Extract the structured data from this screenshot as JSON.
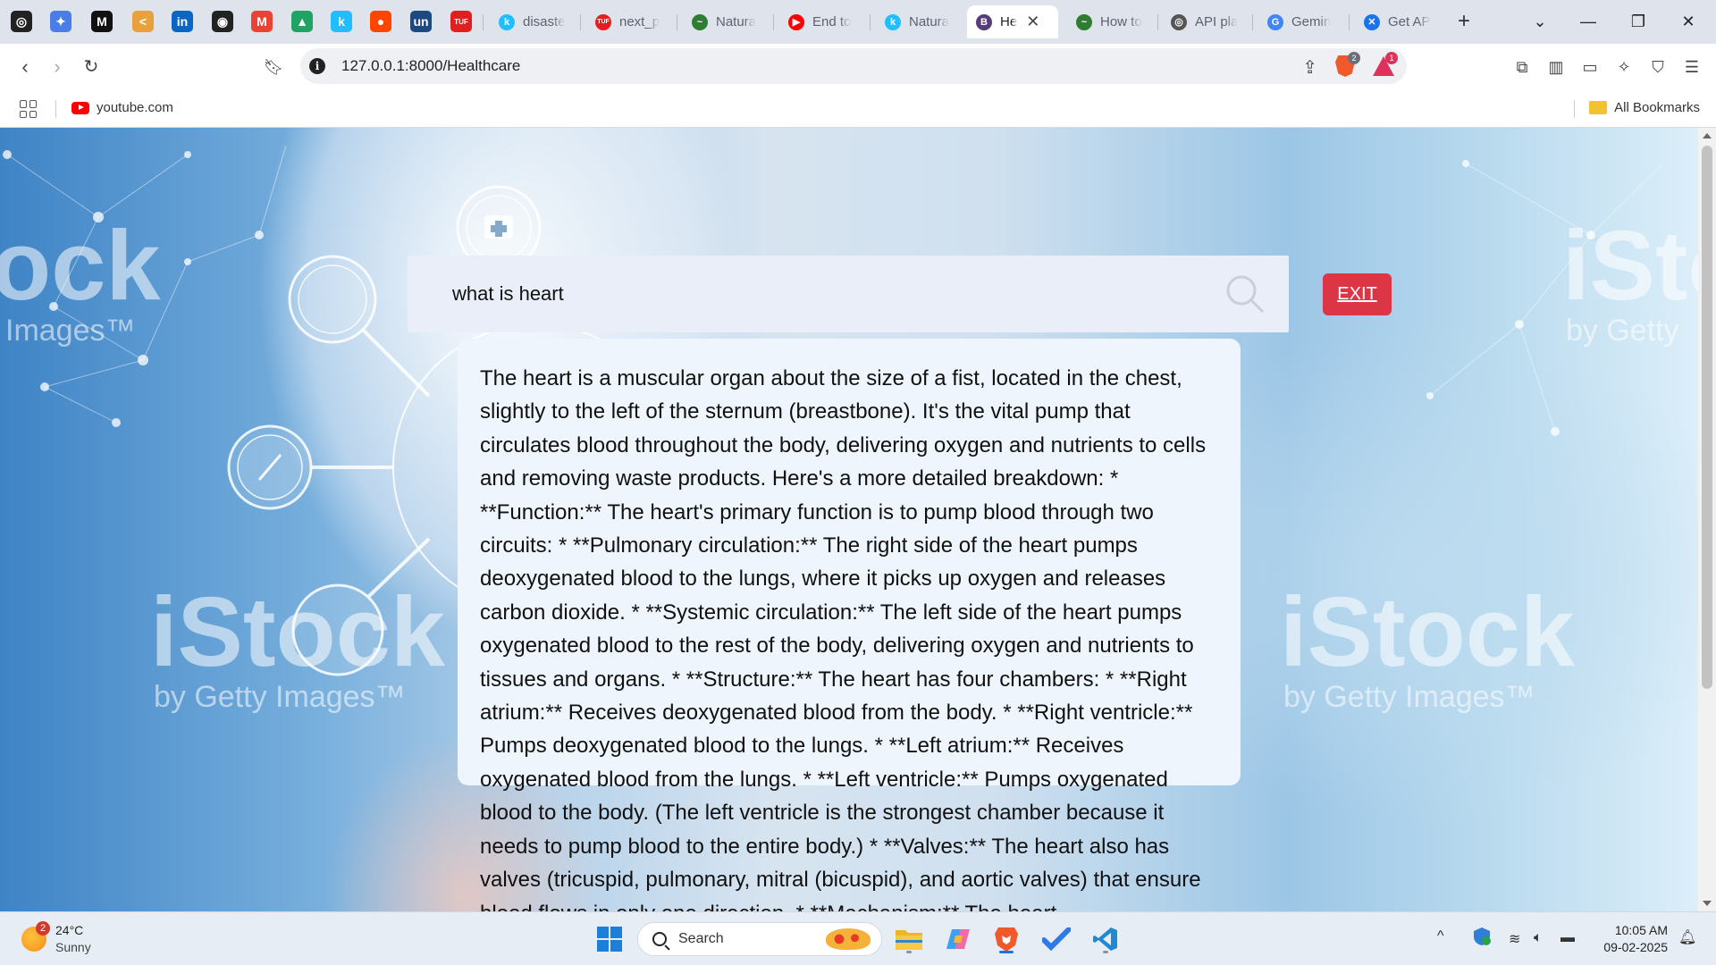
{
  "browser": {
    "pinned_tabs": [
      {
        "name": "openai-icon",
        "glyph": "◎",
        "color": "#222222"
      },
      {
        "name": "gemini-icon",
        "glyph": "✦",
        "color": "#4a7de8"
      },
      {
        "name": "medium-icon",
        "glyph": "M",
        "color": "#111111"
      },
      {
        "name": "claude-icon",
        "glyph": "<",
        "color": "#e9a23b"
      },
      {
        "name": "linkedin-icon",
        "glyph": "in",
        "color": "#0a66c2"
      },
      {
        "name": "github-icon",
        "glyph": "◉",
        "color": "#222222"
      },
      {
        "name": "gmail-icon",
        "glyph": "M",
        "color": "#ea4335"
      },
      {
        "name": "google-drive-icon",
        "glyph": "▲",
        "color": "#1fa463"
      },
      {
        "name": "kaggle-icon",
        "glyph": "k",
        "color": "#20beff"
      },
      {
        "name": "reddit-icon",
        "glyph": "●",
        "color": "#ff4500"
      },
      {
        "name": "unstop-icon",
        "glyph": "un",
        "color": "#1c4980"
      },
      {
        "name": "tuf-icon",
        "glyph": "TUF",
        "color": "#e02020"
      }
    ],
    "tabs": [
      {
        "title": "disaste",
        "favicon": "k",
        "favicon_color": "#20beff",
        "favicon_name": "kaggle-icon"
      },
      {
        "title": "next_p",
        "favicon": "TUF",
        "favicon_color": "#e02020",
        "favicon_name": "tuf-icon"
      },
      {
        "title": "Natura",
        "favicon": "~",
        "favicon_color": "#2e7d32",
        "favicon_name": "huggingface-icon"
      },
      {
        "title": "End to",
        "favicon": "▶",
        "favicon_color": "#ff0000",
        "favicon_name": "youtube-icon"
      },
      {
        "title": "Natura",
        "favicon": "k",
        "favicon_color": "#20beff",
        "favicon_name": "kaggle-icon"
      },
      {
        "title": "He",
        "favicon": "B",
        "favicon_color": "#563d7c",
        "favicon_name": "bootstrap-icon",
        "active": true
      },
      {
        "title": "How to",
        "favicon": "~",
        "favicon_color": "#2e7d32",
        "favicon_name": "huggingface-icon"
      },
      {
        "title": "API pla",
        "favicon": "◎",
        "favicon_color": "#555555",
        "favicon_name": "openai-icon"
      },
      {
        "title": "Gemin",
        "favicon": "G",
        "favicon_color": "#4285f4",
        "favicon_name": "google-icon"
      },
      {
        "title": "Get AP",
        "favicon": "✕",
        "favicon_color": "#1a73e8",
        "favicon_name": "ai-studio-icon"
      }
    ],
    "url": "127.0.0.1:8000/Healthcare",
    "shields_badge": "2",
    "rewards_badge": "1",
    "bookmarks": [
      {
        "label": "youtube.com"
      }
    ],
    "all_bookmarks_label": "All Bookmarks"
  },
  "page": {
    "search_query": "what is heart",
    "exit_label": "EXIT",
    "answer": "The heart is a muscular organ about the size of a fist, located in the chest, slightly to the left of the sternum (breastbone). It's the vital pump that circulates blood throughout the body, delivering oxygen and nutrients to cells and removing waste products. Here's a more detailed breakdown: * **Function:** The heart's primary function is to pump blood through two circuits: * **Pulmonary circulation:** The right side of the heart pumps deoxygenated blood to the lungs, where it picks up oxygen and releases carbon dioxide. * **Systemic circulation:** The left side of the heart pumps oxygenated blood to the rest of the body, delivering oxygen and nutrients to tissues and organs. * **Structure:** The heart has four chambers: * **Right atrium:** Receives deoxygenated blood from the body. * **Right ventricle:** Pumps deoxygenated blood to the lungs. * **Left atrium:** Receives oxygenated blood from the lungs. * **Left ventricle:** Pumps oxygenated blood to the body. (The left ventricle is the strongest chamber because it needs to pump blood to the entire body.) * **Valves:** The heart also has valves (tricuspid, pulmonary, mitral (bicuspid), and aortic valves) that ensure blood flows in only one direction. * **Mechanism:** The heart",
    "watermarks": [
      {
        "big": "iStock",
        "small": "by Getty Images™"
      },
      {
        "big": "iStock",
        "small": "by Getty Images™"
      },
      {
        "big": "iStock",
        "small": "by Getty"
      },
      {
        "big": "ock",
        "small": "Images™"
      }
    ]
  },
  "taskbar": {
    "weather_temp": "24°C",
    "weather_desc": "Sunny",
    "weather_badge": "2",
    "search_label": "Search",
    "clock_time": "10:05 AM",
    "clock_date": "09-02-2025"
  }
}
